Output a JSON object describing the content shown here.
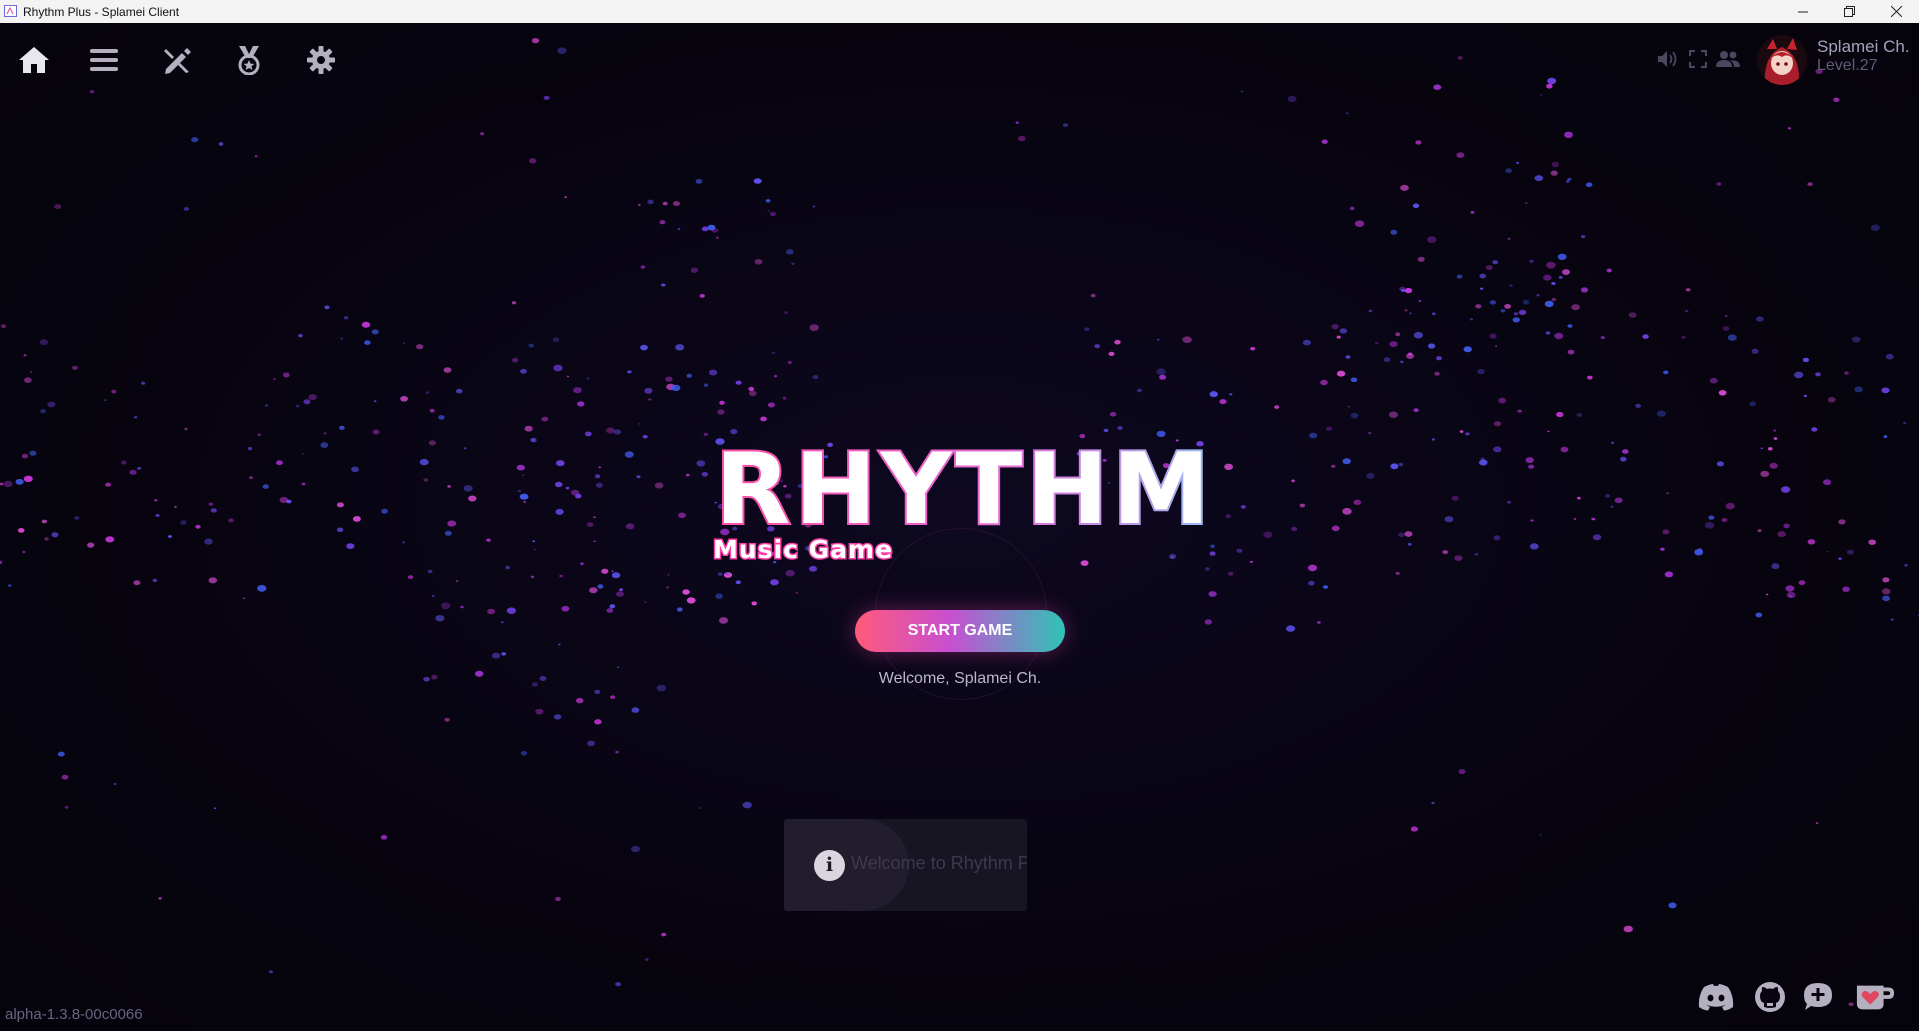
{
  "window": {
    "title": "Rhythm Plus - Splamei Client"
  },
  "nav": {
    "items": [
      {
        "name": "home-icon"
      },
      {
        "name": "menu-icon"
      },
      {
        "name": "editor-icon"
      },
      {
        "name": "medal-icon"
      },
      {
        "name": "settings-icon"
      }
    ]
  },
  "user": {
    "name": "Splamei Ch.",
    "level": "Level.27"
  },
  "logo": {
    "title": "RHYTHM+",
    "subtitle": "Music Game"
  },
  "start_button": {
    "label": "START GAME"
  },
  "welcome": {
    "text": "Welcome, Splamei Ch."
  },
  "toast": {
    "text": "Welcome to Rhythm Plus!",
    "icon": "info-icon"
  },
  "version": {
    "text": "alpha-1.3.8-00c0066"
  },
  "social": [
    {
      "name": "discord-icon"
    },
    {
      "name": "github-icon"
    },
    {
      "name": "feedback-icon"
    },
    {
      "name": "kofi-icon"
    }
  ],
  "colors": {
    "background": "#07040f",
    "pink": "#ff3fa8",
    "blue": "#5a6bff",
    "teal": "#2fc3b7"
  }
}
